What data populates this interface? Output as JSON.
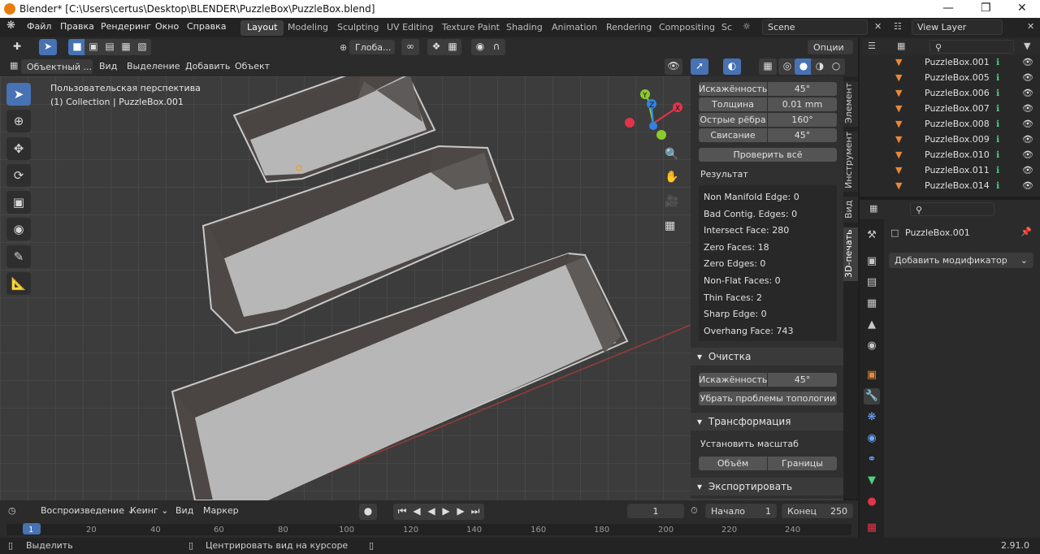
{
  "window": {
    "title": "Blender* [C:\\Users\\certus\\Desktop\\BLENDER\\PuzzleBox\\PuzzleBox.blend]",
    "min_icon": "minimize-icon",
    "max_icon": "restore-icon",
    "close_icon": "close-icon"
  },
  "menu": [
    "Файл",
    "Правка",
    "Рендеринг",
    "Окно",
    "Справка"
  ],
  "workspaces": [
    "Layout",
    "Modeling",
    "Sculpting",
    "UV Editing",
    "Texture Paint",
    "Shading",
    "Animation",
    "Rendering",
    "Compositing",
    "Sc"
  ],
  "scene": "Scene",
  "view_layer": "View Layer",
  "header": {
    "transform_orientation": "Глоба...",
    "options": "Опции",
    "mode": "Объектный ...",
    "view": "Вид",
    "select": "Выделение",
    "add": "Добавить",
    "object": "Объект"
  },
  "viewport": {
    "perspective": "Пользовательская перспектива",
    "collection": "(1) Collection | PuzzleBox.001",
    "gizmo": {
      "x": "X",
      "y": "Y",
      "z": "Z"
    },
    "colors": {
      "x": "#e3344a",
      "y": "#8bcb2b",
      "z": "#2f83e3"
    }
  },
  "npanel": {
    "rows_top": [
      {
        "label": "Искажённость",
        "value": "45°"
      },
      {
        "label": "Толщина",
        "value": "0.01 mm"
      },
      {
        "label": "Острые рёбра",
        "value": "160°"
      },
      {
        "label": "Свисание",
        "value": "45°"
      }
    ],
    "check_all": "Проверить всё",
    "result_title": "Результат",
    "results": [
      "Non Manifold Edge: 0",
      "Bad Contig. Edges: 0",
      "Intersect Face: 280",
      "Zero Faces: 18",
      "Zero Edges: 0",
      "Non-Flat Faces: 0",
      "Thin Faces: 2",
      "Sharp Edge: 0",
      "Overhang Face: 743"
    ],
    "cleanup": "Очистка",
    "cleanup_row": {
      "label": "Искажённость",
      "value": "45°"
    },
    "fix_topology": "Убрать проблемы топологии",
    "transform": "Трансформация",
    "set_scale": "Установить масштаб",
    "volume": "Объём",
    "bounds": "Границы",
    "export": "Экспортировать",
    "tabs": [
      "Элемент",
      "Инструмент",
      "Вид",
      "3D-печать"
    ]
  },
  "outliner": {
    "items": [
      "PuzzleBox.001",
      "PuzzleBox.005",
      "PuzzleBox.006",
      "PuzzleBox.007",
      "PuzzleBox.008",
      "PuzzleBox.009",
      "PuzzleBox.010",
      "PuzzleBox.011",
      "PuzzleBox.014"
    ]
  },
  "properties": {
    "object_name": "PuzzleBox.001",
    "add_modifier": "Добавить модификатор"
  },
  "timeline": {
    "playback": "Воспроизведение",
    "keying": "Кеинг",
    "view": "Вид",
    "marker": "Маркер",
    "current_frame": "1",
    "start_label": "Начало",
    "start": "1",
    "end_label": "Конец",
    "end": "250",
    "ticks": [
      "1",
      "20",
      "40",
      "60",
      "80",
      "100",
      "120",
      "140",
      "160",
      "180",
      "200",
      "220",
      "240"
    ]
  },
  "status": {
    "select": "Выделить",
    "center": "Центрировать вид на курсоре",
    "version": "2.91.0"
  }
}
